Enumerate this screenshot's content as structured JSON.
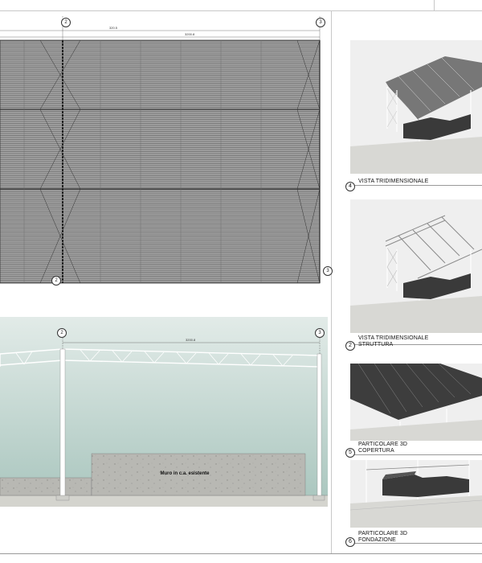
{
  "plan": {
    "grid_top_left": "2",
    "grid_top_right": "3",
    "grid_bottom_left": "2",
    "grid_bottom_right": "3",
    "dim_left": "320.5",
    "dim_right": "3200.8"
  },
  "elevation": {
    "grid_left": "2",
    "grid_right": "3",
    "dim_top": "3200.8",
    "wall_label": "Muro in c.a. esistente"
  },
  "views": [
    {
      "number": "4",
      "title": "VISTA TRIDIMENSIONALE",
      "subtitle": ""
    },
    {
      "number": "2",
      "title": "VISTA TRIDIMENSIONALE",
      "subtitle": "STRUTTURA"
    },
    {
      "number": "5",
      "title": "PARTICOLARE 3D",
      "subtitle": "COPERTURA"
    },
    {
      "number": "6",
      "title": "PARTICOLARE 3D",
      "subtitle": "FONDAZIONE"
    }
  ],
  "colors": {
    "roof_fill": "#9a9a9a",
    "sky_top": "#dde8e4",
    "sky_bottom": "#a9c6bf",
    "concrete": "#b9b9b4",
    "ground": "#d6d6d0",
    "structure": "#ffffff"
  }
}
